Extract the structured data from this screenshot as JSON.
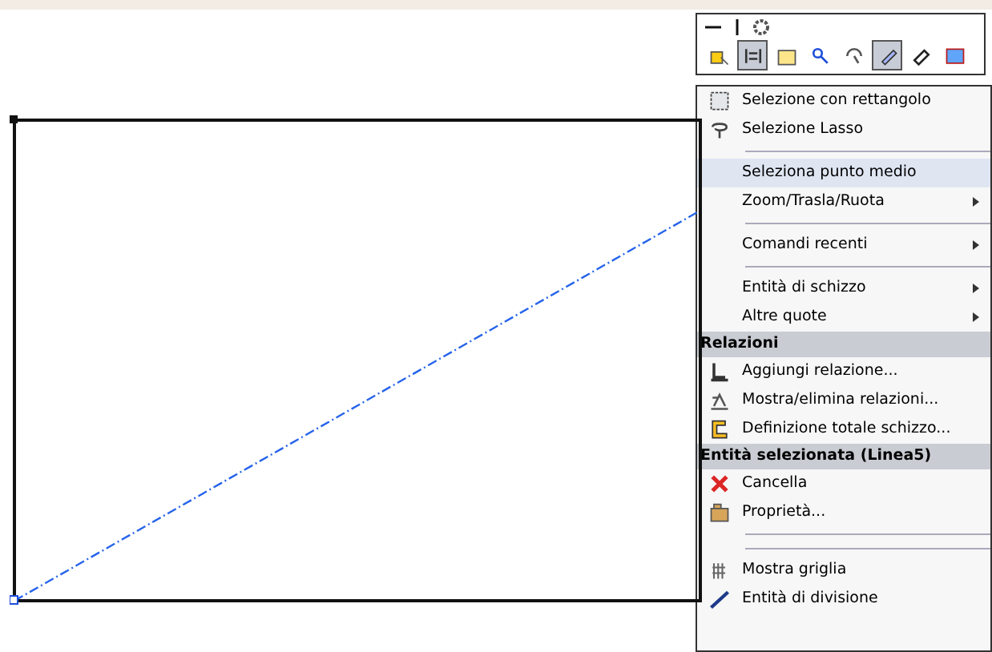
{
  "toolbar": {
    "buttons": [
      {
        "selected": false
      },
      {
        "selected": true
      },
      {
        "selected": false
      },
      {
        "selected": false
      },
      {
        "selected": false
      },
      {
        "selected": true
      },
      {
        "selected": false
      },
      {
        "selected": false
      }
    ]
  },
  "menu": {
    "items": [
      {
        "kind": "item",
        "label": "Selezione con rettangolo",
        "selected": false,
        "submenu": false
      },
      {
        "kind": "item",
        "label": "Selezione Lasso",
        "selected": false,
        "submenu": false
      },
      {
        "kind": "separator"
      },
      {
        "kind": "item",
        "label": "Seleziona punto medio",
        "selected": true,
        "submenu": false
      },
      {
        "kind": "item",
        "label": "Zoom/Trasla/Ruota",
        "selected": false,
        "submenu": true
      },
      {
        "kind": "separator"
      },
      {
        "kind": "item",
        "label": "Comandi recenti",
        "selected": false,
        "submenu": true
      },
      {
        "kind": "separator"
      },
      {
        "kind": "item",
        "label": "Entità di schizzo",
        "selected": false,
        "submenu": true
      },
      {
        "kind": "item",
        "label": "Altre quote",
        "selected": false,
        "submenu": true
      },
      {
        "kind": "header",
        "label": "Relazioni"
      },
      {
        "kind": "item",
        "label": "Aggiungi relazione...",
        "selected": false,
        "submenu": false
      },
      {
        "kind": "item",
        "label": "Mostra/elimina relazioni...",
        "selected": false,
        "submenu": false
      },
      {
        "kind": "item",
        "label": "Definizione totale schizzo...",
        "selected": false,
        "submenu": false
      },
      {
        "kind": "header",
        "label": "Entità selezionata (Linea5)"
      },
      {
        "kind": "item",
        "label": "Cancella",
        "selected": false,
        "submenu": false
      },
      {
        "kind": "item",
        "label": "Proprietà...",
        "selected": false,
        "submenu": false
      },
      {
        "kind": "separator"
      },
      {
        "kind": "separator"
      },
      {
        "kind": "item",
        "label": "Mostra griglia",
        "selected": false,
        "submenu": false
      },
      {
        "kind": "item",
        "label": "Entità di divisione",
        "selected": false,
        "submenu": false
      }
    ]
  }
}
